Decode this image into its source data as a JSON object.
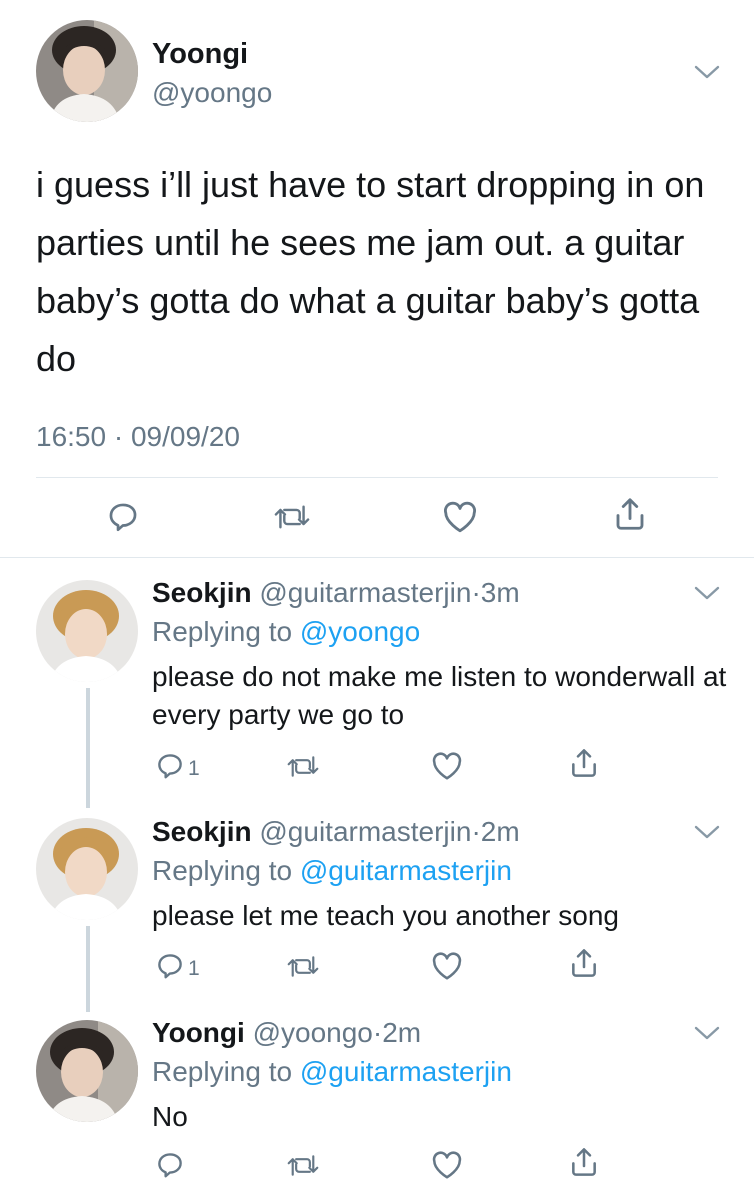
{
  "main_tweet": {
    "name": "Yoongi",
    "handle": "@yoongo",
    "text": "i guess i’ll just have to start dropping in on parties until he sees me jam out. a guitar baby’s gotta do what a guitar baby’s gotta do",
    "time": "16:50",
    "sep": "·",
    "date": "09/09/20"
  },
  "replies": [
    {
      "name": "Seokjin",
      "handle": "@guitarmasterjin",
      "age": "3m",
      "replying_label": "Replying to",
      "replying_to": "@yoongo",
      "text": "please do not make me listen to wonderwall at every party we go to",
      "reply_count": "1"
    },
    {
      "name": "Seokjin",
      "handle": "@guitarmasterjin",
      "age": "2m",
      "replying_label": "Replying to",
      "replying_to": "@guitarmasterjin",
      "text": "please let me teach you another song",
      "reply_count": "1"
    },
    {
      "name": "Yoongi",
      "handle": "@yoongo",
      "age": "2m",
      "replying_label": "Replying to",
      "replying_to": "@guitarmasterjin",
      "text": "No",
      "reply_count": ""
    }
  ],
  "icons": {
    "reply": "reply-icon",
    "retweet": "retweet-icon",
    "like": "like-icon",
    "share": "share-icon",
    "more": "chevron-down-icon"
  },
  "colors": {
    "link": "#1da1f2",
    "secondary": "#657786",
    "text": "#14171a"
  }
}
